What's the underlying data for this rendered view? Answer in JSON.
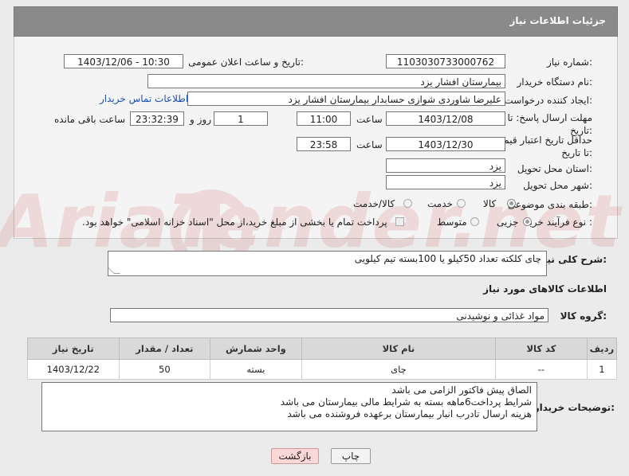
{
  "header": {
    "title": "جزئیات اطلاعات نیاز"
  },
  "need": {
    "number_label": "شماره نیاز:",
    "number_value": "1103030733000762",
    "announce_label": "تاریخ و ساعت اعلان عمومی:",
    "announce_value": "1403/12/06 - 10:30",
    "buyer_org_label": "نام دستگاه خریدار:",
    "buyer_org_value": "بیمارستان افشار یزد",
    "creator_label": "ایجاد کننده درخواست:",
    "creator_value": "علیرضا شاوردی شوازی حسابدار بیمارستان افشار یزد",
    "contact_link": "اطلاعات تماس خریدار",
    "reply_deadline_label": "مهلت ارسال پاسخ: تا تاریخ:",
    "reply_date": "1403/12/08",
    "time_label": "ساعت",
    "reply_time": "11:00",
    "days_value": "1",
    "days_label": "روز و",
    "remaining_value": "23:32:39",
    "remaining_label": "ساعت باقی مانده",
    "price_validity_label": "حداقل تاریخ اعتبار قیمت: تا تاریخ:",
    "price_date": "1403/12/30",
    "price_time": "23:58",
    "province_label": "استان محل تحویل:",
    "province_value": "یزد",
    "city_label": "شهر محل تحویل:",
    "city_value": "یزد",
    "category_label": "طبقه بندی موضوعی:",
    "category_options": [
      "کالا",
      "خدمت",
      "کالا/خدمت"
    ],
    "category_selected": "کالا",
    "process_label": "نوع فرآیند خرید :",
    "process_options": [
      "جزیی",
      "متوسط"
    ],
    "process_selected": "جزیی",
    "payment_note": "پرداخت تمام یا بخشی از مبلغ خرید،از محل \"اسناد خزانه اسلامی\" خواهد بود."
  },
  "summary": {
    "label": "شرح کلی نیاز:",
    "value": "چای کلکته تعداد 50کیلو یا 100بسته تیم کیلویی"
  },
  "goods_section": {
    "title": "اطلاعات کالاهای مورد نیاز"
  },
  "goods_group": {
    "label": "گروه کالا:",
    "value": "مواد غذائی و نوشیدنی"
  },
  "table": {
    "headers": [
      "ردیف",
      "کد کالا",
      "نام کالا",
      "واحد شمارش",
      "تعداد / مقدار",
      "تاریخ نیاز"
    ],
    "rows": [
      [
        "1",
        "--",
        "چای",
        "بسته",
        "50",
        "1403/12/22"
      ]
    ]
  },
  "buyer_notes": {
    "label": "توضیحات خریدار:",
    "lines": [
      "الصاق پیش فاکتور الزامی می باشد",
      "شرایط پرداخت6ماهه بسته به شرایط مالی بیمارستان می باشد",
      "هزینه ارسال تادرب انبار بیمارستان برعهده فروشنده می باشد"
    ]
  },
  "buttons": {
    "print": "چاپ",
    "back": "بازگشت"
  },
  "watermark": {
    "text": "AriaTender.net"
  }
}
